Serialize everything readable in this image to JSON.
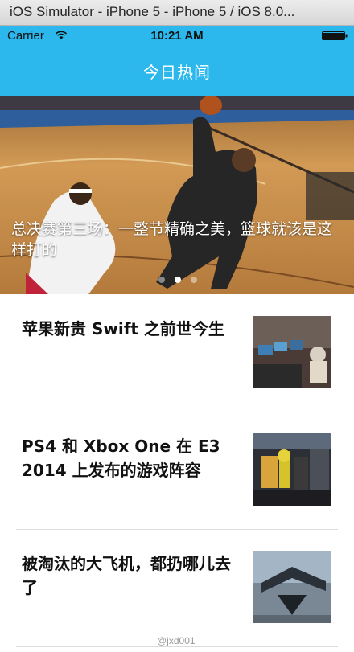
{
  "window": {
    "title": "iOS Simulator - iPhone 5 - iPhone 5 / iOS 8.0..."
  },
  "status_bar": {
    "carrier": "Carrier",
    "time": "10:21 AM"
  },
  "nav": {
    "title": "今日热闻"
  },
  "banner": {
    "caption": "总决赛第三场：一整节精确之美，篮球就该是这样打的",
    "dots": [
      {
        "active": false
      },
      {
        "active": true
      },
      {
        "active": false
      }
    ]
  },
  "news": [
    {
      "title": "苹果新贵 Swift 之前世今生"
    },
    {
      "title": "PS4 和 Xbox One 在 E3 2014 上发布的游戏阵容"
    },
    {
      "title": "被淘汰的大飞机，都扔哪儿去了"
    }
  ],
  "watermark": "@jxd001",
  "colors": {
    "header": "#2cb8ec",
    "divider": "#dcdcdc"
  }
}
